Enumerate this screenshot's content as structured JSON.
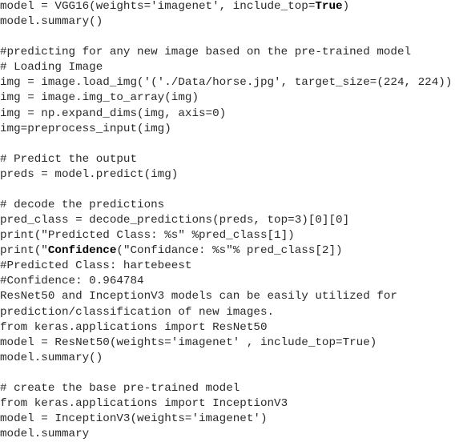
{
  "code_lines": [
    [
      {
        "t": "model = VGG16(weights='imagenet', include_top="
      },
      {
        "t": "True",
        "b": true
      },
      {
        "t": ")"
      }
    ],
    [
      {
        "t": "model.summary()"
      }
    ],
    [
      {
        "t": ""
      }
    ],
    [
      {
        "t": "#predicting for any new image based on the pre-trained model"
      }
    ],
    [
      {
        "t": "# Loading Image"
      }
    ],
    [
      {
        "t": "img = image.load_img('('./Data/horse.jpg', target_size=(224, 224))"
      }
    ],
    [
      {
        "t": "img = image.img_to_array(img)"
      }
    ],
    [
      {
        "t": "img = np.expand_dims(img, axis=0)"
      }
    ],
    [
      {
        "t": "img=preprocess_input(img)"
      }
    ],
    [
      {
        "t": ""
      }
    ],
    [
      {
        "t": "# Predict the output"
      }
    ],
    [
      {
        "t": "preds = model.predict(img)"
      }
    ],
    [
      {
        "t": ""
      }
    ],
    [
      {
        "t": "# decode the predictions"
      }
    ],
    [
      {
        "t": "pred_class = decode_predictions(preds, top=3)[0][0]"
      }
    ],
    [
      {
        "t": "print(\"Predicted Class: %s\" %pred_class[1])"
      }
    ],
    [
      {
        "t": "print(\""
      },
      {
        "t": "Confidence",
        "b": true
      },
      {
        "t": "(\"Confidance: %s\"% pred_class[2])"
      }
    ],
    [
      {
        "t": "#Predicted Class: hartebeest"
      }
    ],
    [
      {
        "t": "#Confidence: 0.964784"
      }
    ],
    [
      {
        "t": "ResNet50 and InceptionV3 models can be easily utilized for"
      }
    ],
    [
      {
        "t": "prediction/classification of new images."
      }
    ],
    [
      {
        "t": "from keras.applications import ResNet50"
      }
    ],
    [
      {
        "t": "model = ResNet50(weights='imagenet' , include_top=True)"
      }
    ],
    [
      {
        "t": "model.summary()"
      }
    ],
    [
      {
        "t": ""
      }
    ],
    [
      {
        "t": "# create the base pre-trained model"
      }
    ],
    [
      {
        "t": "from keras.applications import InceptionV3"
      }
    ],
    [
      {
        "t": "model = InceptionV3(weights='imagenet')"
      }
    ],
    [
      {
        "t": "model.summary"
      }
    ]
  ]
}
